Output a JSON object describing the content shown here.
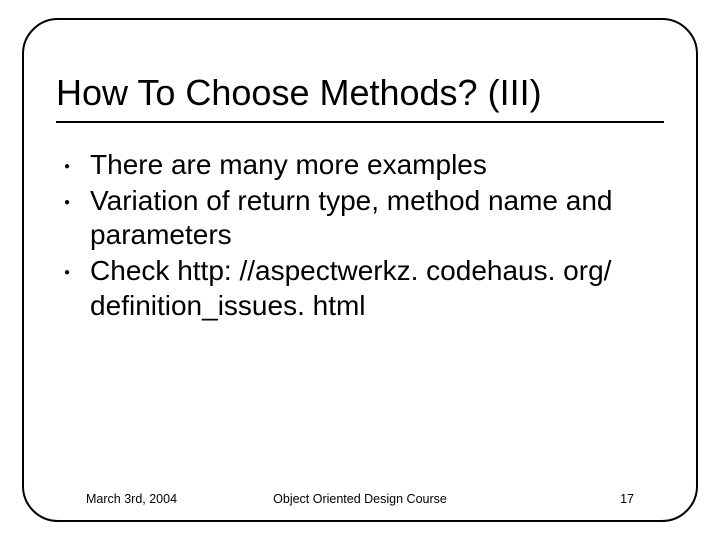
{
  "title": "How To Choose Methods? (III)",
  "bullets": [
    "There are many more examples",
    "Variation of return type, method name and parameters",
    "Check http: //aspectwerkz. codehaus. org/ definition_issues. html"
  ],
  "footer": {
    "date": "March 3rd, 2004",
    "course": "Object Oriented Design Course",
    "page": "17"
  }
}
